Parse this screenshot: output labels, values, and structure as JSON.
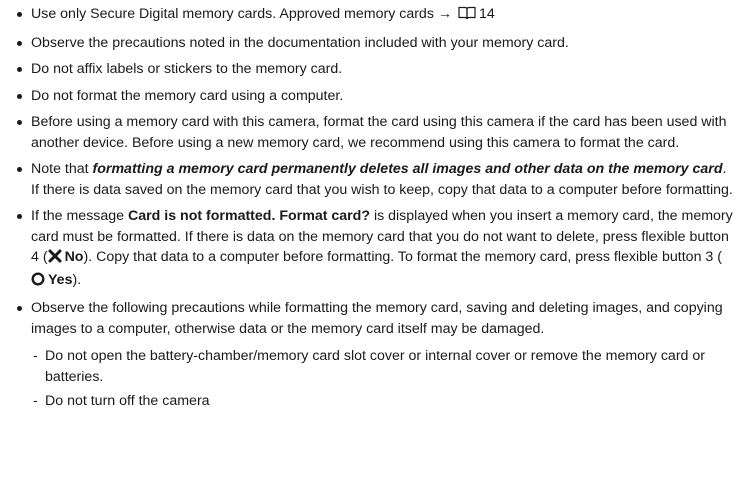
{
  "bullets": {
    "b1": {
      "text": "Use only Secure Digital memory cards. Approved memory cards → ",
      "icon": "book-reference-icon",
      "page_ref": "14"
    },
    "b2": {
      "text": "Observe the precautions noted in the documentation included with your memory card."
    },
    "b3": {
      "text": "Do not affix labels or stickers to the memory card."
    },
    "b4": {
      "text": "Do not format the memory card using a computer."
    },
    "b5": {
      "text": "Before using a memory card with this camera, format the card using this camera if the card has been used with another device. Before using a new memory card, we recommend using this camera to format the card."
    },
    "b6": {
      "pre": "Note that ",
      "emphasis": "formatting a memory card permanently deletes all images and other data on the memory card",
      "post": ". If there is data saved on the memory card that you wish to keep, copy that data to a computer before formatting."
    },
    "b7": {
      "pre": "If the message ",
      "message": "Card is not formatted. Format card?",
      "mid": " is displayed when you insert a memory card, the memory card must be formatted. If there is data on the memory card that you do not want to delete, press flexible button 4 (",
      "no_icon": "x-mark-icon",
      "no_label": "No",
      "mid2": "). Copy that data to a computer before formatting. To format the memory card, press flexible button 3 (",
      "yes_icon": "circle-icon",
      "yes_label": "Yes",
      "post": ")."
    },
    "b8": {
      "text": "Observe the following precautions while formatting the memory card, saving and deleting images, and copying images to a computer, otherwise data or the memory card itself may be damaged.",
      "subs": [
        "Do not open the battery-chamber/memory card slot cover or internal cover or remove the memory card or batteries.",
        "Do not turn off the camera"
      ]
    }
  }
}
